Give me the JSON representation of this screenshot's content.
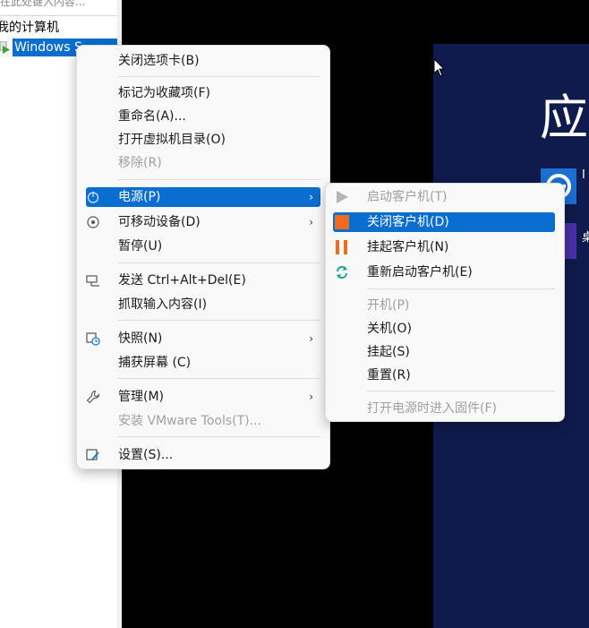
{
  "tree": {
    "search_placeholder": "在此处键入内容...",
    "my_computer": "我的计算机",
    "vm_name": "Windows S"
  },
  "guest": {
    "heading_char": "应",
    "tile1_text": "I",
    "tile2_text": "桌"
  },
  "main_menu": {
    "close_tab": "关闭选项卡(B)",
    "mark_favorite": "标记为收藏项(F)",
    "rename": "重命名(A)...",
    "open_vm_dir": "打开虚拟机目录(O)",
    "remove": "移除(R)",
    "power": "电源(P)",
    "removable_devices": "可移动设备(D)",
    "pause": "暂停(U)",
    "send_cad": "发送 Ctrl+Alt+Del(E)",
    "grab_input": "抓取输入内容(I)",
    "snapshot": "快照(N)",
    "capture_screen": "捕获屏幕 (C)",
    "manage": "管理(M)",
    "install_tools": "安装 VMware Tools(T)...",
    "settings": "设置(S)..."
  },
  "power_menu": {
    "start_guest": "启动客户机(T)",
    "shutdown_guest": "关闭客户机(D)",
    "suspend_guest": "挂起客户机(N)",
    "restart_guest": "重新启动客户机(E)",
    "power_on": "开机(P)",
    "power_off": "关机(O)",
    "suspend": "挂起(S)",
    "reset": "重置(R)",
    "power_on_to_firmware": "打开电源时进入固件(F)"
  },
  "colors": {
    "highlight": "#0a6ed1",
    "guest_bg": "#0f1a4d",
    "shutdown_icon": "#f06a22",
    "suspend_icon": "#f06a22",
    "restart_icon": "#1aa39a"
  }
}
